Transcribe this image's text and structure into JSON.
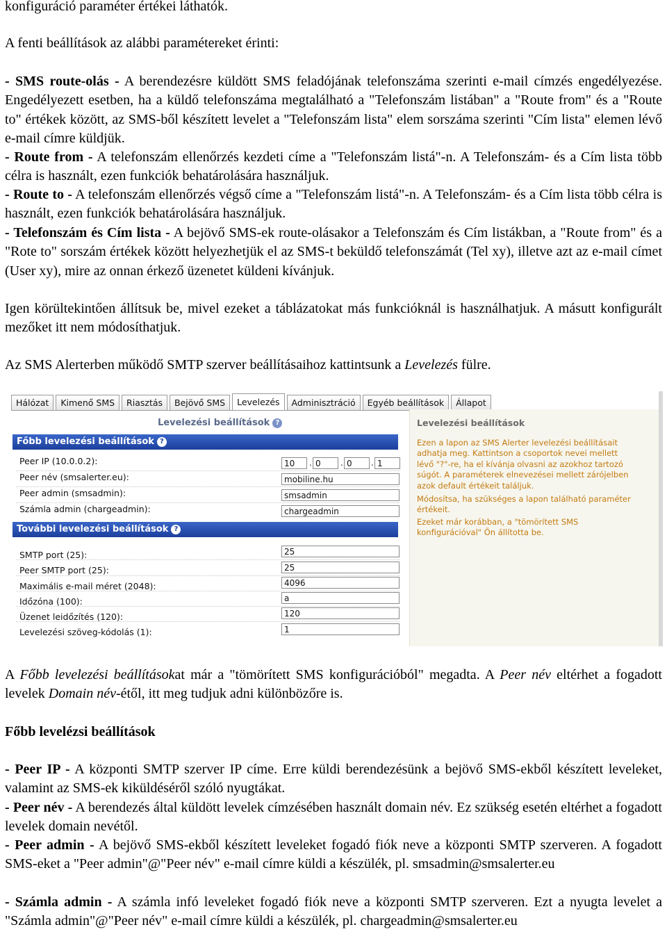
{
  "intro": {
    "line0": "konfiguráció paraméter értékei láthatók.",
    "affects": "A fenti beállítások az alábbi paramétereket érinti:"
  },
  "params": [
    {
      "term": "- SMS route-olás -",
      "text": " A berendezésre küldött SMS feladójának telefonszáma szerinti e-mail címzés engedélyezése. Engedélyezett esetben, ha a küldő telefonszáma megtalálható a \"Telefonszám listában\" a \"Route from\" és a \"Route to\" értékek között, az SMS-ből készített levelet a \"Telefonszám lista\" elem sorszáma szerinti \"Cím lista\" elemen lévő e-mail címre küldjük."
    },
    {
      "term": "- Route from -",
      "text": " A telefonszám ellenőrzés kezdeti címe a \"Telefonszám listá\"-n. A Telefonszám- és a Cím lista több célra is használt, ezen funkciók behatárolására használjuk."
    },
    {
      "term": "- Route to -",
      "text": " A telefonszám ellenőrzés végső címe a \"Telefonszám listá\"-n. A Telefonszám- és a Cím lista több célra is használt, ezen funkciók behatárolására használjuk."
    },
    {
      "term": "- Telefonszám és Cím lista -",
      "text": " A bejövő SMS-ek route-olásakor a Telefonszám és Cím listákban, a \"Route from\" és a \"Rote to\" sorszám értékek között helyezhetjük el az SMS-t beküldő telefonszámát (Tel xy), illetve azt az e-mail címet (User xy), mire az onnan érkező üzenetet küldeni kívánjuk."
    }
  ],
  "caution": "Igen körültekintően állítsuk be, mivel ezeket a táblázatokat más funkcióknál is használhatjuk. A másutt konfigurált mezőket itt nem módosíthatjuk.",
  "smtp_intro": {
    "before": "Az SMS Alerterben működő SMTP szerver beállításaihoz kattintsunk a ",
    "link": "Levelezés",
    "after": " fülre."
  },
  "screenshot": {
    "tabs": [
      "Hálózat",
      "Kimenő SMS",
      "Riasztás",
      "Bejövő SMS",
      "Levelezés",
      "Adminisztráció",
      "Egyéb beállítások",
      "Állapot"
    ],
    "active_tab": "Levelezés",
    "page_title": "Levelezési beállítások",
    "help_glyph": "?",
    "section1": {
      "title": "Főbb levelezési beállítások",
      "rows": [
        {
          "label": "Peer IP (10.0.0.2):",
          "value": [
            "10",
            "0",
            "0",
            "1"
          ]
        },
        {
          "label": "Peer név (smsalerter.eu):",
          "value": "mobiline.hu"
        },
        {
          "label": "Peer admin (smsadmin):",
          "value": "smsadmin"
        },
        {
          "label": "Számla admin (chargeadmin):",
          "value": "chargeadmin"
        }
      ]
    },
    "section2": {
      "title": "További levelezési beállítások",
      "rows": [
        {
          "label": "SMTP port (25):",
          "value": "25"
        },
        {
          "label": "Peer SMTP port (25):",
          "value": "25"
        },
        {
          "label": "Maximális e-mail méret (2048):",
          "value": "4096"
        },
        {
          "label": "Időzóna (100):",
          "value": "a"
        },
        {
          "label": "Üzenet leidőzítés (120):",
          "value": "120"
        },
        {
          "label": "Levelezési szöveg-kódolás (1):",
          "value": "1"
        }
      ]
    },
    "side": {
      "title": "Levelezési beállítások",
      "p1": "Ezen a lapon az SMS Alerter levelezési beállításait adhatja meg. Kattintson a csoportok nevei mellett lévő \"?\"-re, ha el kívánja olvasni az azokhoz tartozó súgót. A paraméterek elnevezései mellett zárójelben azok default értékeit találjuk.",
      "p2": "Módosítsa, ha szükséges a lapon található paraméter értékeit.",
      "p3": "Ezeket már korábban, a \"tömörített SMS konfigurációval\" Ön állította be."
    }
  },
  "after_shot": {
    "s1": "A ",
    "s1_i": "Főbb levelezési beállítások",
    "s2": "at már a \"tömörített SMS konfigurációból\" megadta. A ",
    "s2_i": "Peer név",
    "s3": " eltérhet a fogadott levelek ",
    "s3_i": "Domain név",
    "s4": "-étől, itt meg tudjuk adni különbözőre is."
  },
  "heading": "Főbb levelézsi beállítások",
  "params2": [
    {
      "term": "- Peer IP -",
      "text": " A központi SMTP szerver IP címe. Erre küldi berendezésünk a bejövő SMS-ekből készített leveleket, valamint az SMS-ek kiküldéséről szóló nyugtákat."
    },
    {
      "term": "- Peer név -",
      "text": " A berendezés által küldött levelek címzésében használt domain név. Ez szükség esetén eltérhet a fogadott levelek domain nevétől."
    },
    {
      "term": "- Peer admin -",
      "text": " A bejövő SMS-ekből készített leveleket fogadó fiók neve a központi SMTP szerveren. A fogadott SMS-eket a \"Peer admin\"@\"Peer név\" e-mail címre küldi a készülék, pl. smsadmin@smsalerter.eu"
    },
    {
      "term": "- Számla admin -",
      "text": " A számla infó leveleket fogadó fiók neve a központi SMTP szerveren. Ezt a nyugta levelet a \"Számla admin\"@\"Peer név\" e-mail címre küldi a készülék, pl. chargeadmin@smsalerter.eu"
    }
  ]
}
